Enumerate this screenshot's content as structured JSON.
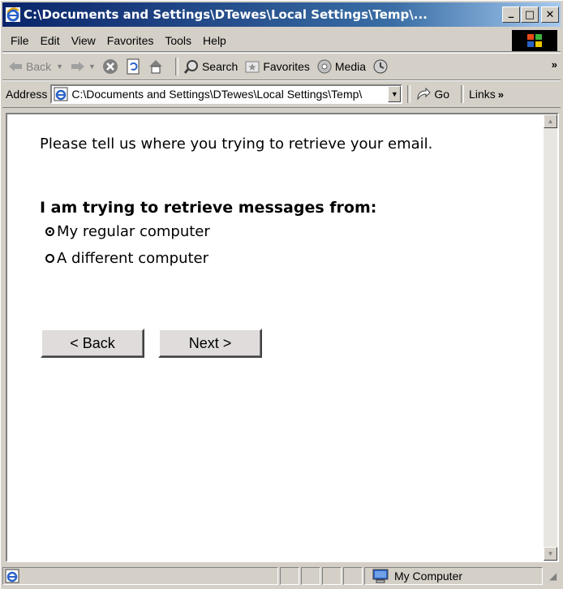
{
  "window": {
    "title": "C:\\Documents and Settings\\DTewes\\Local Settings\\Temp\\...",
    "minimize_glyph": "_",
    "maximize_glyph": "□",
    "close_glyph": "✕"
  },
  "menu": {
    "items": [
      "File",
      "Edit",
      "View",
      "Favorites",
      "Tools",
      "Help"
    ]
  },
  "toolbar": {
    "back_label": "Back",
    "search_label": "Search",
    "favorites_label": "Favorites",
    "media_label": "Media",
    "more_glyph": "»"
  },
  "address": {
    "label": "Address",
    "value": "C:\\Documents and Settings\\DTewes\\Local Settings\\Temp\\",
    "go_label": "Go",
    "links_label": "Links",
    "links_more": "»"
  },
  "page": {
    "intro": "Please tell us where you trying to retrieve your email.",
    "question": "I am trying to retrieve messages from:",
    "options": [
      {
        "label": "My regular computer",
        "selected": true
      },
      {
        "label": "A different computer",
        "selected": false
      }
    ],
    "back_button": "< Back",
    "next_button": "Next >"
  },
  "status": {
    "zone": "My Computer"
  },
  "colors": {
    "titlebar": "#0a246a",
    "chrome": "#d4d0c8"
  }
}
